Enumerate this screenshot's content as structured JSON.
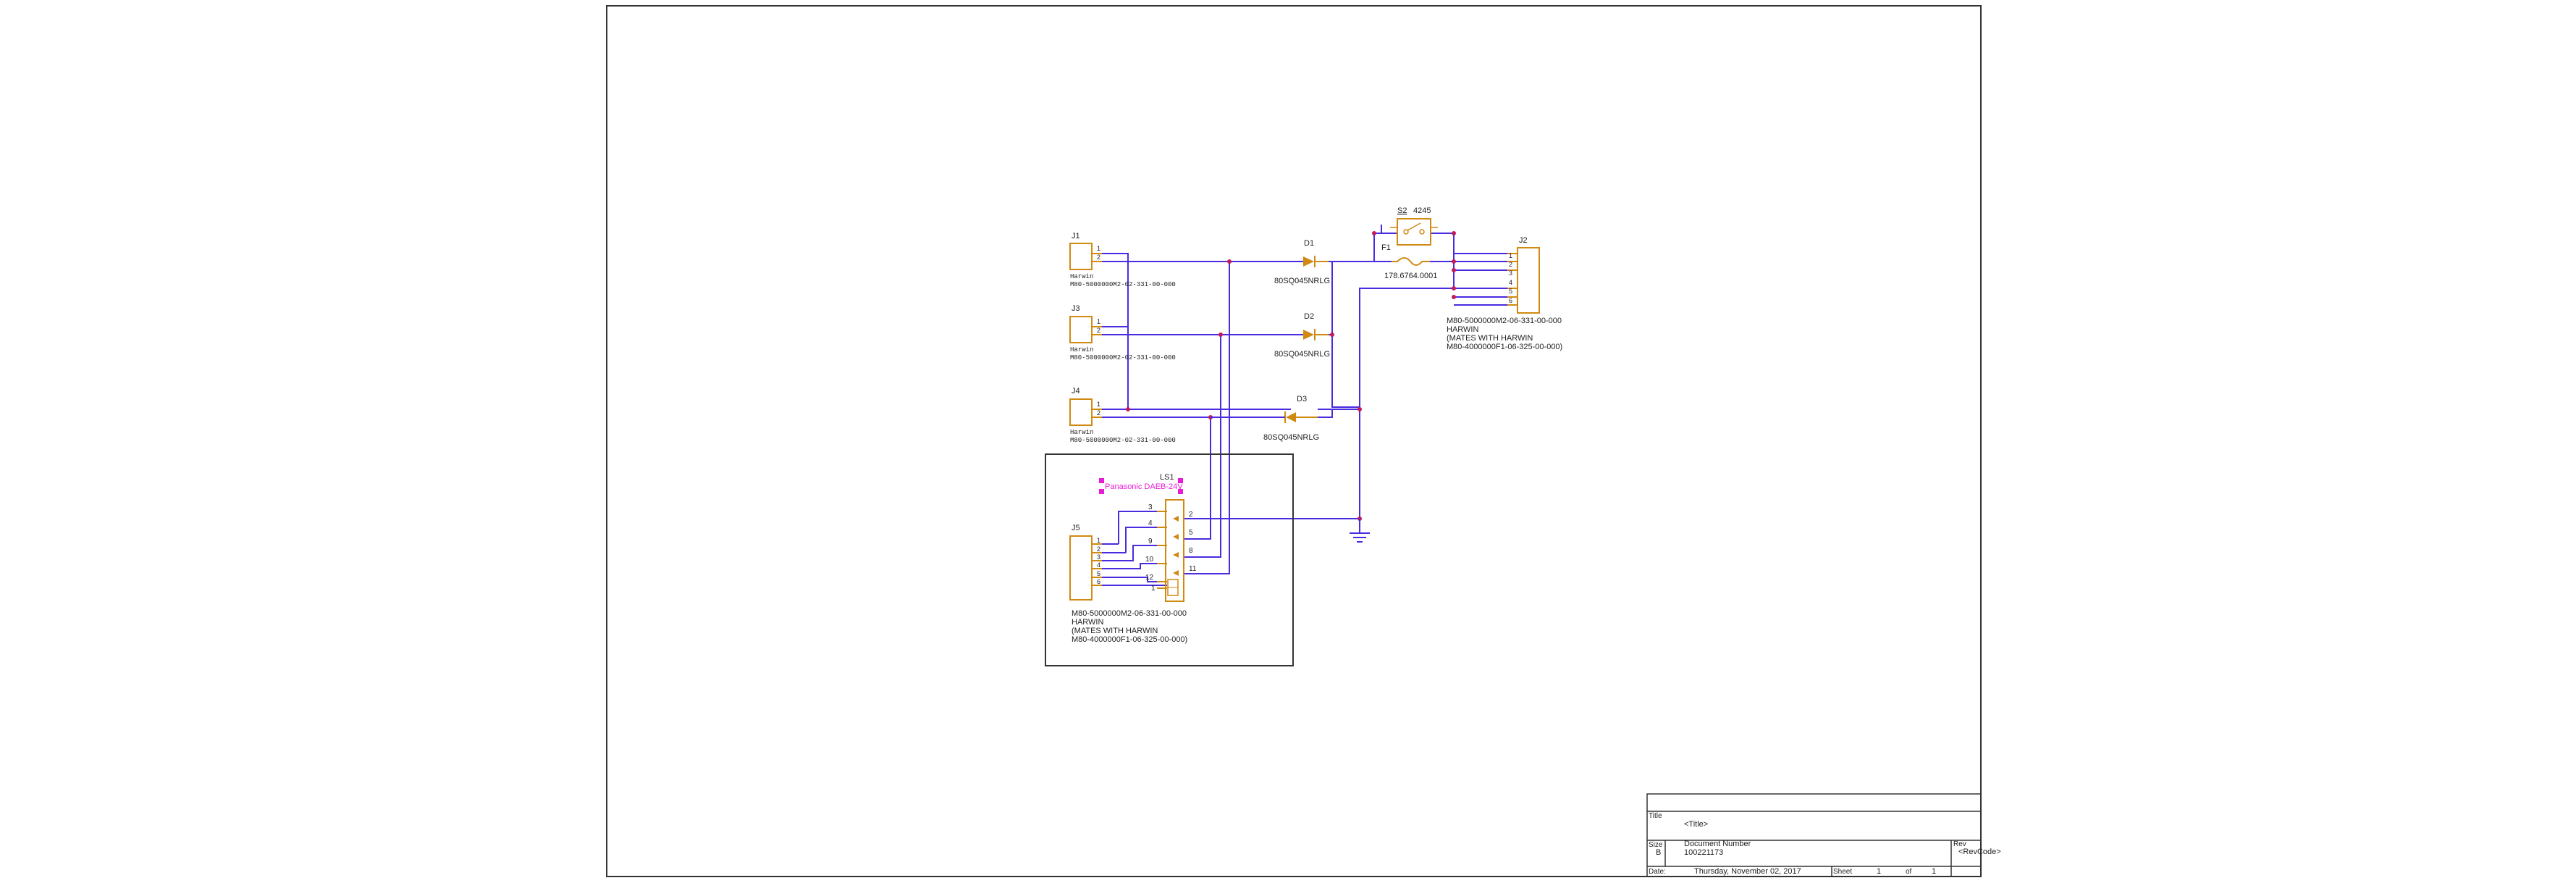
{
  "colors": {
    "wire": "#4b2be0",
    "part": "#d08a12",
    "junction": "#c21a5a",
    "border": "#333333",
    "text": "#222222",
    "selection": "#e81bd8"
  },
  "parts": {
    "j1": {
      "ref": "J1",
      "mfr": "Harwin",
      "pn": "M80-5000000M2-02-331-00-000",
      "pins": [
        "1",
        "2"
      ]
    },
    "j3": {
      "ref": "J3",
      "mfr": "Harwin",
      "pn": "M80-5000000M2-02-331-00-000",
      "pins": [
        "1",
        "2"
      ]
    },
    "j4": {
      "ref": "J4",
      "mfr": "Harwin",
      "pn": "M80-5000000M2-02-331-00-000",
      "pins": [
        "1",
        "2"
      ]
    },
    "d1": {
      "ref": "D1",
      "value": "80SQ045NRLG"
    },
    "d2": {
      "ref": "D2",
      "value": "80SQ045NRLG"
    },
    "d3": {
      "ref": "D3",
      "value": "80SQ045NRLG"
    },
    "s2": {
      "ref": "S2",
      "value": "4245"
    },
    "f1": {
      "ref": "F1",
      "value": "178.6764.0001"
    },
    "j2": {
      "ref": "J2",
      "pins": [
        "1",
        "2",
        "3",
        "4",
        "5",
        "6"
      ],
      "lines": [
        "M80-5000000M2-06-331-00-000",
        "HARWIN",
        "(MATES WITH HARWIN",
        "M80-4000000F1-06-325-00-000)"
      ]
    },
    "ls1": {
      "ref": "LS1",
      "value": "Panasonic DAEB-24V",
      "pins_left": [
        "3",
        "4",
        "9",
        "10",
        "12",
        "1"
      ],
      "pins_right": [
        "2",
        "5",
        "8",
        "11"
      ]
    },
    "j5": {
      "pins": [
        "1",
        "2",
        "3",
        "4",
        "5",
        "6"
      ],
      "lines": [
        "M80-5000000M2-06-331-00-000",
        "HARWIN",
        "(MATES WITH HARWIN",
        "M80-4000000F1-06-325-00-000)"
      ]
    }
  },
  "title_block": {
    "title_label": "Title",
    "title_value": "<Title>",
    "size_label": "Size",
    "size_value": "B",
    "docnum_label": "Document Number",
    "docnum_value": "100221173",
    "rev_label": "Rev",
    "rev_value": "<RevCode>",
    "date_label": "Date:",
    "date_value": "Thursday, November 02, 2017",
    "sheet_label": "Sheet",
    "sheet_value": "1",
    "of_label": "of",
    "of_value": "1"
  }
}
